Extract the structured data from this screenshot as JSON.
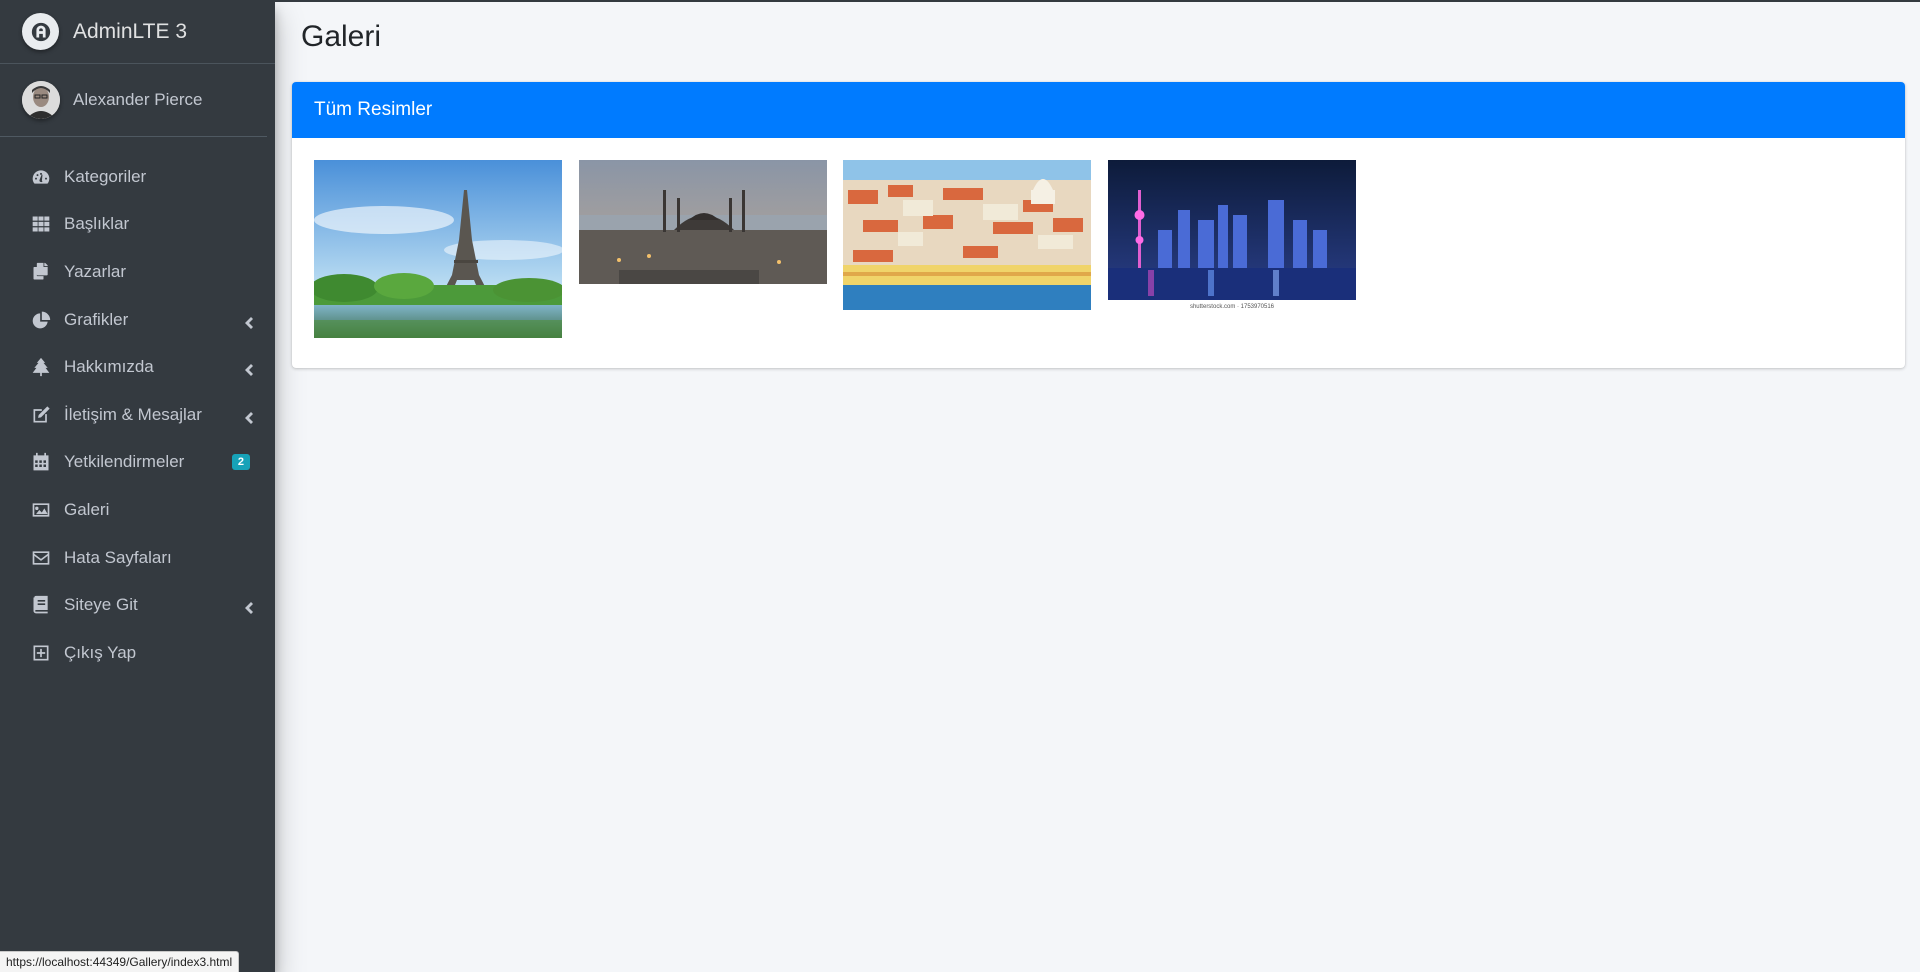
{
  "brand": {
    "name": "AdminLTE 3"
  },
  "user": {
    "name": "Alexander Pierce"
  },
  "sidebar": {
    "items": [
      {
        "label": "Kategoriler",
        "icon": "tachometer-icon"
      },
      {
        "label": "Başlıklar",
        "icon": "grid-icon"
      },
      {
        "label": "Yazarlar",
        "icon": "copy-icon"
      },
      {
        "label": "Grafikler",
        "icon": "pie-chart-icon",
        "has_submenu": true
      },
      {
        "label": "Hakkımızda",
        "icon": "tree-icon",
        "has_submenu": true
      },
      {
        "label": "İletişim & Mesajlar",
        "icon": "edit-icon",
        "has_submenu": true
      },
      {
        "label": "Yetkilendirmeler",
        "icon": "calendar-icon",
        "badge": "2"
      },
      {
        "label": "Galeri",
        "icon": "image-icon"
      },
      {
        "label": "Hata Sayfaları",
        "icon": "envelope-icon"
      },
      {
        "label": "Siteye Git",
        "icon": "book-icon",
        "has_submenu": true
      },
      {
        "label": "Çıkış Yap",
        "icon": "plus-square-icon"
      }
    ]
  },
  "main": {
    "page_title": "Galeri",
    "card_title": "Tüm Resimler",
    "photos": [
      {
        "subject": "eiffel-tower"
      },
      {
        "subject": "istanbul-mosque"
      },
      {
        "subject": "lisbon-city"
      },
      {
        "subject": "shanghai-night",
        "caption": "shutterstock.com · 1753970516"
      }
    ]
  },
  "status_bar": {
    "url": "https://localhost:44349/Gallery/index3.html"
  },
  "colors": {
    "sidebar": "#343a40",
    "accent": "#007bff",
    "badge": "#17a2b8",
    "background": "#f4f6f9"
  }
}
